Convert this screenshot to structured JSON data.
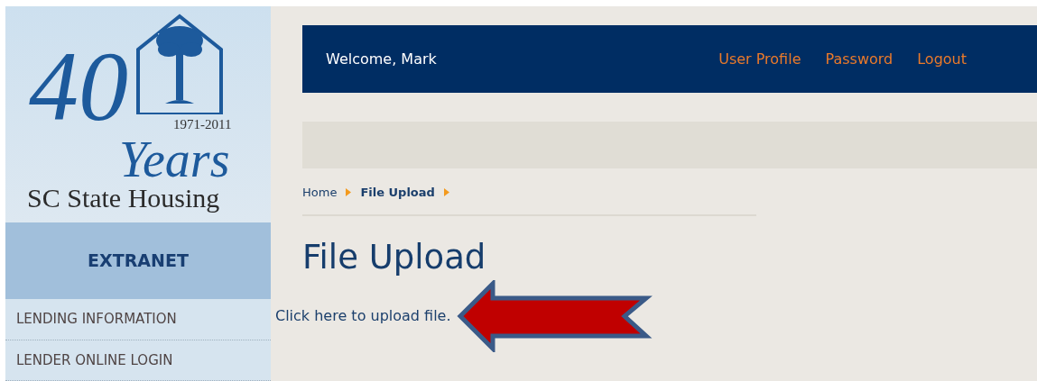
{
  "logo": {
    "number": "40",
    "word": "Years",
    "years": "1971-2011",
    "name": "SC State Housing"
  },
  "sidebar": {
    "heading": "EXTRANET",
    "items": [
      {
        "label": "LENDING INFORMATION"
      },
      {
        "label": "LENDER ONLINE LOGIN"
      }
    ]
  },
  "header": {
    "welcome": "Welcome, Mark",
    "links": [
      "User Profile",
      "Password",
      "Logout"
    ]
  },
  "breadcrumb": [
    {
      "label": "Home",
      "current": false
    },
    {
      "label": "File Upload",
      "current": true
    }
  ],
  "title": "File Upload",
  "upload_link": "Click here to upload file."
}
